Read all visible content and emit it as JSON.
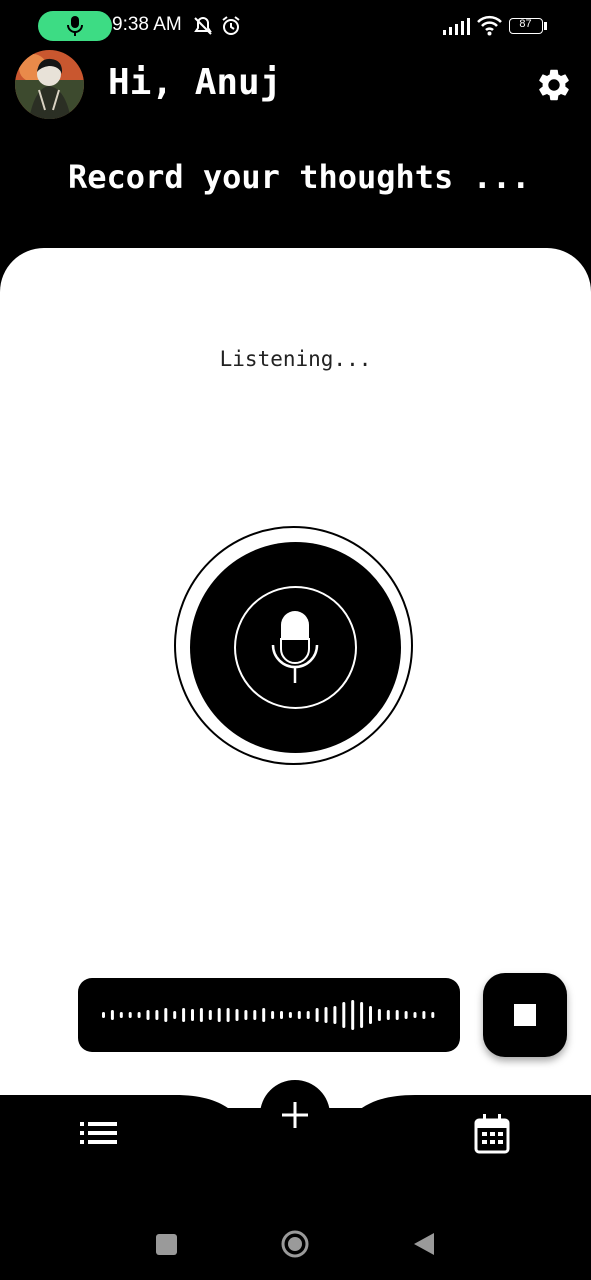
{
  "status_bar": {
    "time": "9:38 AM",
    "battery": "87",
    "pill_color": "#3ddc84"
  },
  "header": {
    "greeting": "Hi, Anuj",
    "headline": "Record your thoughts ..."
  },
  "recorder": {
    "status_text": "Listening..."
  },
  "icons": {
    "settings": "gear-icon",
    "microphone": "microphone-icon",
    "stop": "stop-icon",
    "add": "plus-icon",
    "list": "list-icon",
    "calendar": "calendar-icon"
  },
  "colors": {
    "background": "#000000",
    "card": "#ffffff",
    "accent": "#3ddc84"
  }
}
